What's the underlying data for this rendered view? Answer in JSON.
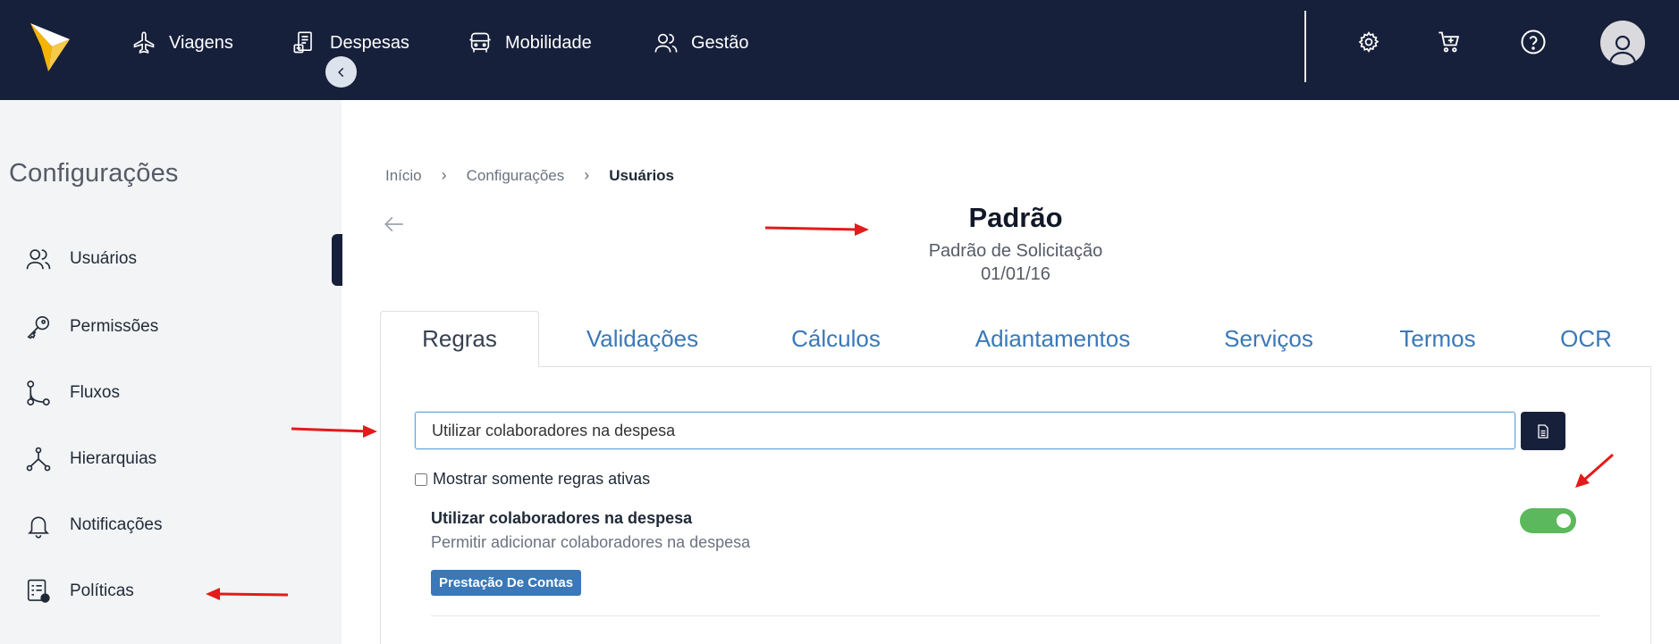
{
  "nav": {
    "items": [
      {
        "label": "Viagens",
        "icon": "airplane-icon"
      },
      {
        "label": "Despesas",
        "icon": "receipt-icon"
      },
      {
        "label": "Mobilidade",
        "icon": "car-icon"
      },
      {
        "label": "Gestão",
        "icon": "users-icon"
      }
    ],
    "actions": [
      "gear-icon",
      "cart-add-icon",
      "help-icon",
      "avatar-icon"
    ]
  },
  "sidebar": {
    "title": "Configurações",
    "items": [
      {
        "label": "Usuários",
        "icon": "users-icon",
        "active": true
      },
      {
        "label": "Permissões",
        "icon": "key-icon"
      },
      {
        "label": "Fluxos",
        "icon": "flow-icon"
      },
      {
        "label": "Hierarquias",
        "icon": "hierarchy-icon"
      },
      {
        "label": "Notificações",
        "icon": "bell-icon"
      },
      {
        "label": "Políticas",
        "icon": "policy-icon"
      }
    ]
  },
  "breadcrumb": {
    "items": [
      "Início",
      "Configurações",
      "Usuários"
    ]
  },
  "header": {
    "title": "Padrão",
    "subtitle": "Padrão de Solicitação",
    "date": "01/01/16"
  },
  "tabs": [
    {
      "label": "Regras",
      "active": true
    },
    {
      "label": "Validações"
    },
    {
      "label": "Cálculos"
    },
    {
      "label": "Adiantamentos"
    },
    {
      "label": "Serviços"
    },
    {
      "label": "Termos"
    },
    {
      "label": "OCR"
    }
  ],
  "filter": {
    "search_value": "Utilizar colaboradores na despesa",
    "checkbox_label": "Mostrar somente regras ativas",
    "checkbox_checked": false
  },
  "rules": [
    {
      "title": "Utilizar colaboradores na despesa",
      "description": "Permitir adicionar colaboradores na despesa",
      "badge": "Prestação De Contas",
      "enabled": true
    }
  ],
  "colors": {
    "navbar": "#17203a",
    "accent": "#3a78b7",
    "toggle_on": "#5cb85c",
    "annotation": "#e31b1b"
  }
}
